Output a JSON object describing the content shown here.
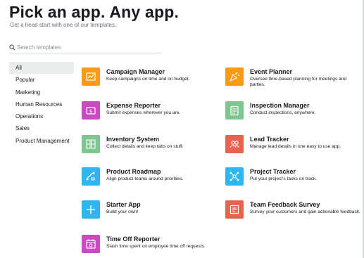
{
  "header": {
    "title": "Pick an app. Any app.",
    "subtitle": "Get a head start with one of our templates."
  },
  "search": {
    "placeholder": "Search templates",
    "value": "",
    "icon": "search-icon"
  },
  "categories": [
    "All",
    "Popular",
    "Marketing",
    "Human Resources",
    "Operations",
    "Sales",
    "Product Management"
  ],
  "selected_category": "All",
  "colors": {
    "orange": "#f89b12",
    "magenta": "#c84bc1",
    "green": "#7fc58f",
    "blue": "#2db6f0",
    "red": "#e8624f"
  },
  "templates": [
    {
      "name": "Campaign Manager",
      "desc": "Keep campaigns on time and on budget.",
      "color": "#f89b12",
      "icon": "campaign-chart-icon"
    },
    {
      "name": "Event Planner",
      "desc": "Oversee time-based planning for meetings and parties.",
      "color": "#f89b12",
      "icon": "party-popper-icon"
    },
    {
      "name": "Expense Reporter",
      "desc": "Submit expenses wherever you are.",
      "color": "#c84bc1",
      "icon": "money-icon"
    },
    {
      "name": "Inspection Manager",
      "desc": "Conduct inspections, anywhere.",
      "color": "#7fc58f",
      "icon": "clipboard-icon"
    },
    {
      "name": "Inventory System",
      "desc": "Collect details and keep tabs on stuff.",
      "color": "#7fc58f",
      "icon": "shelves-icon"
    },
    {
      "name": "Lead Tracker",
      "desc": "Manage lead details in one easy to use app.",
      "color": "#e8624f",
      "icon": "people-icon"
    },
    {
      "name": "Product Roadmap",
      "desc": "Align product teams around priorities.",
      "color": "#2db6f0",
      "icon": "roadmap-icon"
    },
    {
      "name": "Project Tracker",
      "desc": "Put your project's tasks on track.",
      "color": "#2db6f0",
      "icon": "network-icon"
    },
    {
      "name": "Starter App",
      "desc": "Build your own!",
      "color": "#2db6f0",
      "icon": "plus-icon"
    },
    {
      "name": "Team Feedback Survey",
      "desc": "Survey your customers and gain actionable feedback.",
      "color": "#e8624f",
      "icon": "survey-icon"
    },
    {
      "name": "Time Off Reporter",
      "desc": "Slash time spent on employee time off requests.",
      "color": "#c84bc1",
      "icon": "calendar-icon"
    }
  ]
}
